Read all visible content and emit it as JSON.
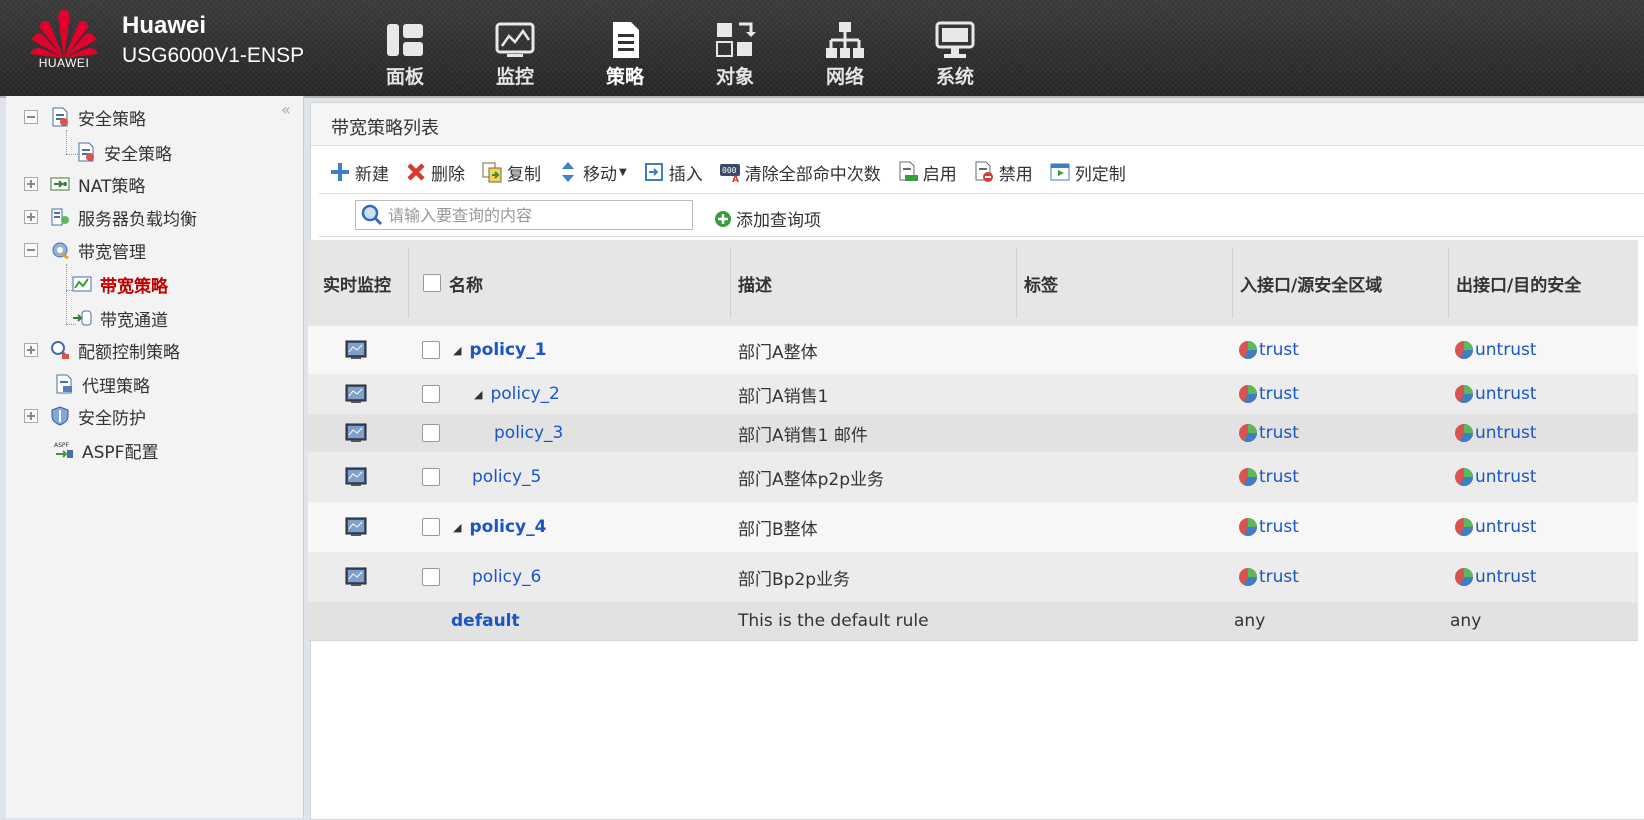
{
  "header": {
    "logo_text": "HUAWEI",
    "brand": "Huawei",
    "device": "USG6000V1-ENSP",
    "nav": [
      {
        "label": "面板",
        "icon": "dashboard-icon"
      },
      {
        "label": "监控",
        "icon": "monitor-icon"
      },
      {
        "label": "策略",
        "icon": "policy-icon"
      },
      {
        "label": "对象",
        "icon": "object-icon"
      },
      {
        "label": "网络",
        "icon": "network-icon"
      },
      {
        "label": "系统",
        "icon": "system-icon"
      }
    ],
    "active_nav": "策略"
  },
  "sidebar": {
    "items": [
      {
        "label": "安全策略",
        "expander": "minus"
      },
      {
        "label": "安全策略"
      },
      {
        "label": "NAT策略",
        "expander": "plus"
      },
      {
        "label": "服务器负载均衡",
        "expander": "plus"
      },
      {
        "label": "带宽管理",
        "expander": "minus"
      },
      {
        "label": "带宽策略",
        "selected": true
      },
      {
        "label": "带宽通道"
      },
      {
        "label": "配额控制策略",
        "expander": "plus"
      },
      {
        "label": "代理策略"
      },
      {
        "label": "安全防护",
        "expander": "plus"
      },
      {
        "label": "ASPF配置"
      }
    ],
    "collapse_glyph": "«"
  },
  "main": {
    "title": "带宽策略列表",
    "toolbar": {
      "new": "新建",
      "delete": "删除",
      "copy": "复制",
      "move": "移动",
      "insert": "插入",
      "clear_hits": "清除全部命中次数",
      "enable": "启用",
      "disable": "禁用",
      "columns": "列定制"
    },
    "search": {
      "placeholder": "请输入要查询的内容",
      "add_query": "添加查询项"
    },
    "table": {
      "headers": {
        "monitor": "实时监控",
        "name": "名称",
        "desc": "描述",
        "tag": "标签",
        "src": "入接口/源安全区域",
        "dst": "出接口/目的安全"
      },
      "rows": [
        {
          "name": "policy_1",
          "desc": "部门A整体",
          "src": "trust",
          "dst": "untrust"
        },
        {
          "name": "policy_2",
          "desc": "部门A销售1",
          "src": "trust",
          "dst": "untrust"
        },
        {
          "name": "policy_3",
          "desc": "部门A销售1 邮件",
          "src": "trust",
          "dst": "untrust"
        },
        {
          "name": "policy_5",
          "desc": "部门A整体p2p业务",
          "src": "trust",
          "dst": "untrust"
        },
        {
          "name": "policy_4",
          "desc": "部门B整体",
          "src": "trust",
          "dst": "untrust"
        },
        {
          "name": "policy_6",
          "desc": "部门Bp2p业务",
          "src": "trust",
          "dst": "untrust"
        },
        {
          "name": "default",
          "desc": "This is the default rule",
          "src": "any",
          "dst": "any"
        }
      ]
    }
  }
}
